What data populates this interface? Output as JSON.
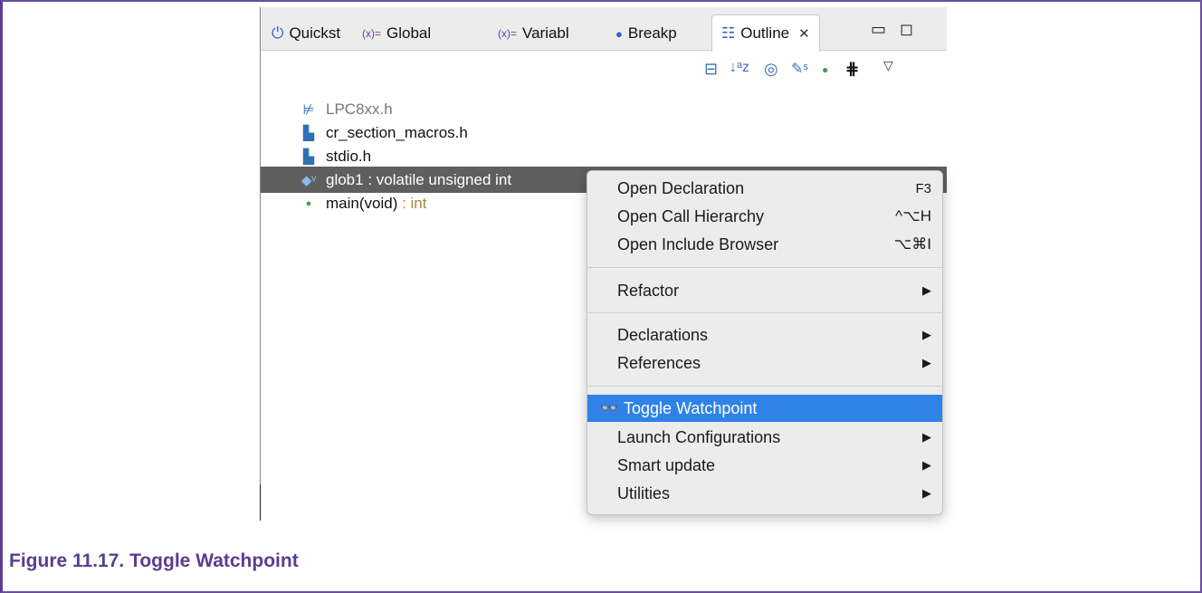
{
  "figure": {
    "caption": "Figure 11.17. Toggle Watchpoint"
  },
  "tabs": [
    {
      "label": "Quickst",
      "icon": "power-icon",
      "icon_glyph": "⏻"
    },
    {
      "label": "Global",
      "icon": "global-variables-icon",
      "icon_glyph": "(x)="
    },
    {
      "label": "Variabl",
      "icon": "variables-icon",
      "icon_glyph": "(x)="
    },
    {
      "label": "Breakp",
      "icon": "breakpoints-icon",
      "icon_glyph": "●"
    },
    {
      "label": "Outline",
      "icon": "outline-icon",
      "icon_glyph": "☷",
      "active": true,
      "close": "✕"
    }
  ],
  "window_controls": {
    "minimize": "▭",
    "maximize": "◻"
  },
  "toolbar_icons": [
    {
      "name": "collapse-all-icon",
      "glyph": "⊟",
      "color": "#3b6fb5"
    },
    {
      "name": "sort-alpha-icon",
      "glyph": "↓ᵃz",
      "color": "#3b6fb5"
    },
    {
      "name": "hide-fields-icon",
      "glyph": "◎",
      "color": "#3b6fb5"
    },
    {
      "name": "hide-static-icon",
      "glyph": "✎ˢ",
      "color": "#3b6fb5"
    },
    {
      "name": "hide-nonpublic-icon",
      "glyph": "●",
      "color": "#3fa34d"
    },
    {
      "name": "group-macros-icon",
      "glyph": "⋕",
      "color": "#111111"
    },
    {
      "name": "view-menu-icon",
      "glyph": "▽",
      "color": "#333333"
    }
  ],
  "outline": [
    {
      "label": "LPC8xx.h",
      "icon": "include-unresolved-icon",
      "glyph": "⊭",
      "muted": true
    },
    {
      "label": "cr_section_macros.h",
      "icon": "include-icon",
      "glyph": "▙"
    },
    {
      "label": "stdio.h",
      "icon": "include-icon",
      "glyph": "▙"
    },
    {
      "label": "glob1 : volatile unsigned int",
      "icon": "variable-icon",
      "glyph": "◆ᵛ",
      "selected": true
    },
    {
      "label": "main(void)",
      "suffix": " : int",
      "icon": "function-icon",
      "glyph": "●"
    }
  ],
  "context_menu": {
    "items": [
      {
        "label": "Open Declaration",
        "shortcut": "F3"
      },
      {
        "label": "Open Call Hierarchy",
        "shortcut": "^⌥H"
      },
      {
        "label": "Open Include Browser",
        "shortcut": "⌥⌘I"
      },
      {
        "separator": true
      },
      {
        "label": "Refactor",
        "submenu": "▶"
      },
      {
        "separator": true
      },
      {
        "label": "Declarations",
        "submenu": "▶"
      },
      {
        "label": "References",
        "submenu": "▶"
      },
      {
        "separator": true
      },
      {
        "label": "Toggle Watchpoint",
        "icon": "watchpoint-icon",
        "glyph": "👓",
        "highlighted": true
      },
      {
        "label": "Launch Configurations",
        "submenu": "▶"
      },
      {
        "label": "Smart update",
        "submenu": "▶"
      },
      {
        "label": "Utilities",
        "submenu": "▶"
      }
    ]
  },
  "colors": {
    "figure_border": "#5b3d8f",
    "selection_row": "#5f5f5f",
    "menu_highlight": "#2f82e6"
  }
}
